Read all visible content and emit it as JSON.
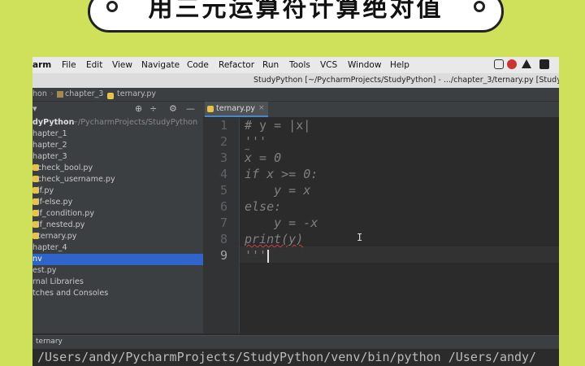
{
  "banner": {
    "title": "用三元运算符计算绝对值"
  },
  "menubar": {
    "app_name": "arm",
    "items": [
      "File",
      "Edit",
      "View",
      "Navigate",
      "Code",
      "Refactor",
      "Run",
      "Tools",
      "VCS",
      "Window",
      "Help"
    ]
  },
  "window_title": "StudyPython [~/PycharmProjects/StudyPython] - .../chapter_3/ternary.py [StudyPyth",
  "breadcrumb": [
    "hon",
    "chapter_3",
    "ternary.py"
  ],
  "project": {
    "root_name": "dyPython",
    "root_path": "~/PycharmProjects/StudyPython",
    "items": [
      {
        "label": "hapter_1",
        "type": "folder"
      },
      {
        "label": "hapter_2",
        "type": "folder"
      },
      {
        "label": "hapter_3",
        "type": "folder"
      },
      {
        "label": "check_bool.py",
        "type": "file"
      },
      {
        "label": "check_username.py",
        "type": "file"
      },
      {
        "label": "if.py",
        "type": "file"
      },
      {
        "label": "if-else.py",
        "type": "file"
      },
      {
        "label": "if_condition.py",
        "type": "file"
      },
      {
        "label": "if_nested.py",
        "type": "file"
      },
      {
        "label": "ternary.py",
        "type": "file"
      },
      {
        "label": "hapter_4",
        "type": "folder"
      },
      {
        "label": "nv",
        "type": "folder"
      },
      {
        "label": "est.py",
        "type": "file"
      },
      {
        "label": "rnal Libraries",
        "type": "folder"
      },
      {
        "label": "tches and Consoles",
        "type": "folder"
      }
    ]
  },
  "editor": {
    "tab_label": "ternary.py",
    "line_numbers": [
      "1",
      "2",
      "3",
      "4",
      "5",
      "6",
      "7",
      "8",
      "9"
    ],
    "lines": [
      "# y = |x|",
      "'''",
      "x = 0",
      "if x >= 0:",
      "    y = x",
      "else:",
      "    y = -x",
      "print(y)",
      "'''"
    ],
    "fold_marker": "~"
  },
  "run": {
    "tab_label": "ternary",
    "console_text": "/Users/andy/PycharmProjects/StudyPython/venv/bin/python /Users/andy/"
  },
  "colors": {
    "background": "#cfe05a",
    "selection": "#2f65ca",
    "comment": "#808080"
  },
  "icons": [
    "globe-icon",
    "split-icon",
    "gear-icon",
    "minimize-icon",
    "tray-icons"
  ]
}
